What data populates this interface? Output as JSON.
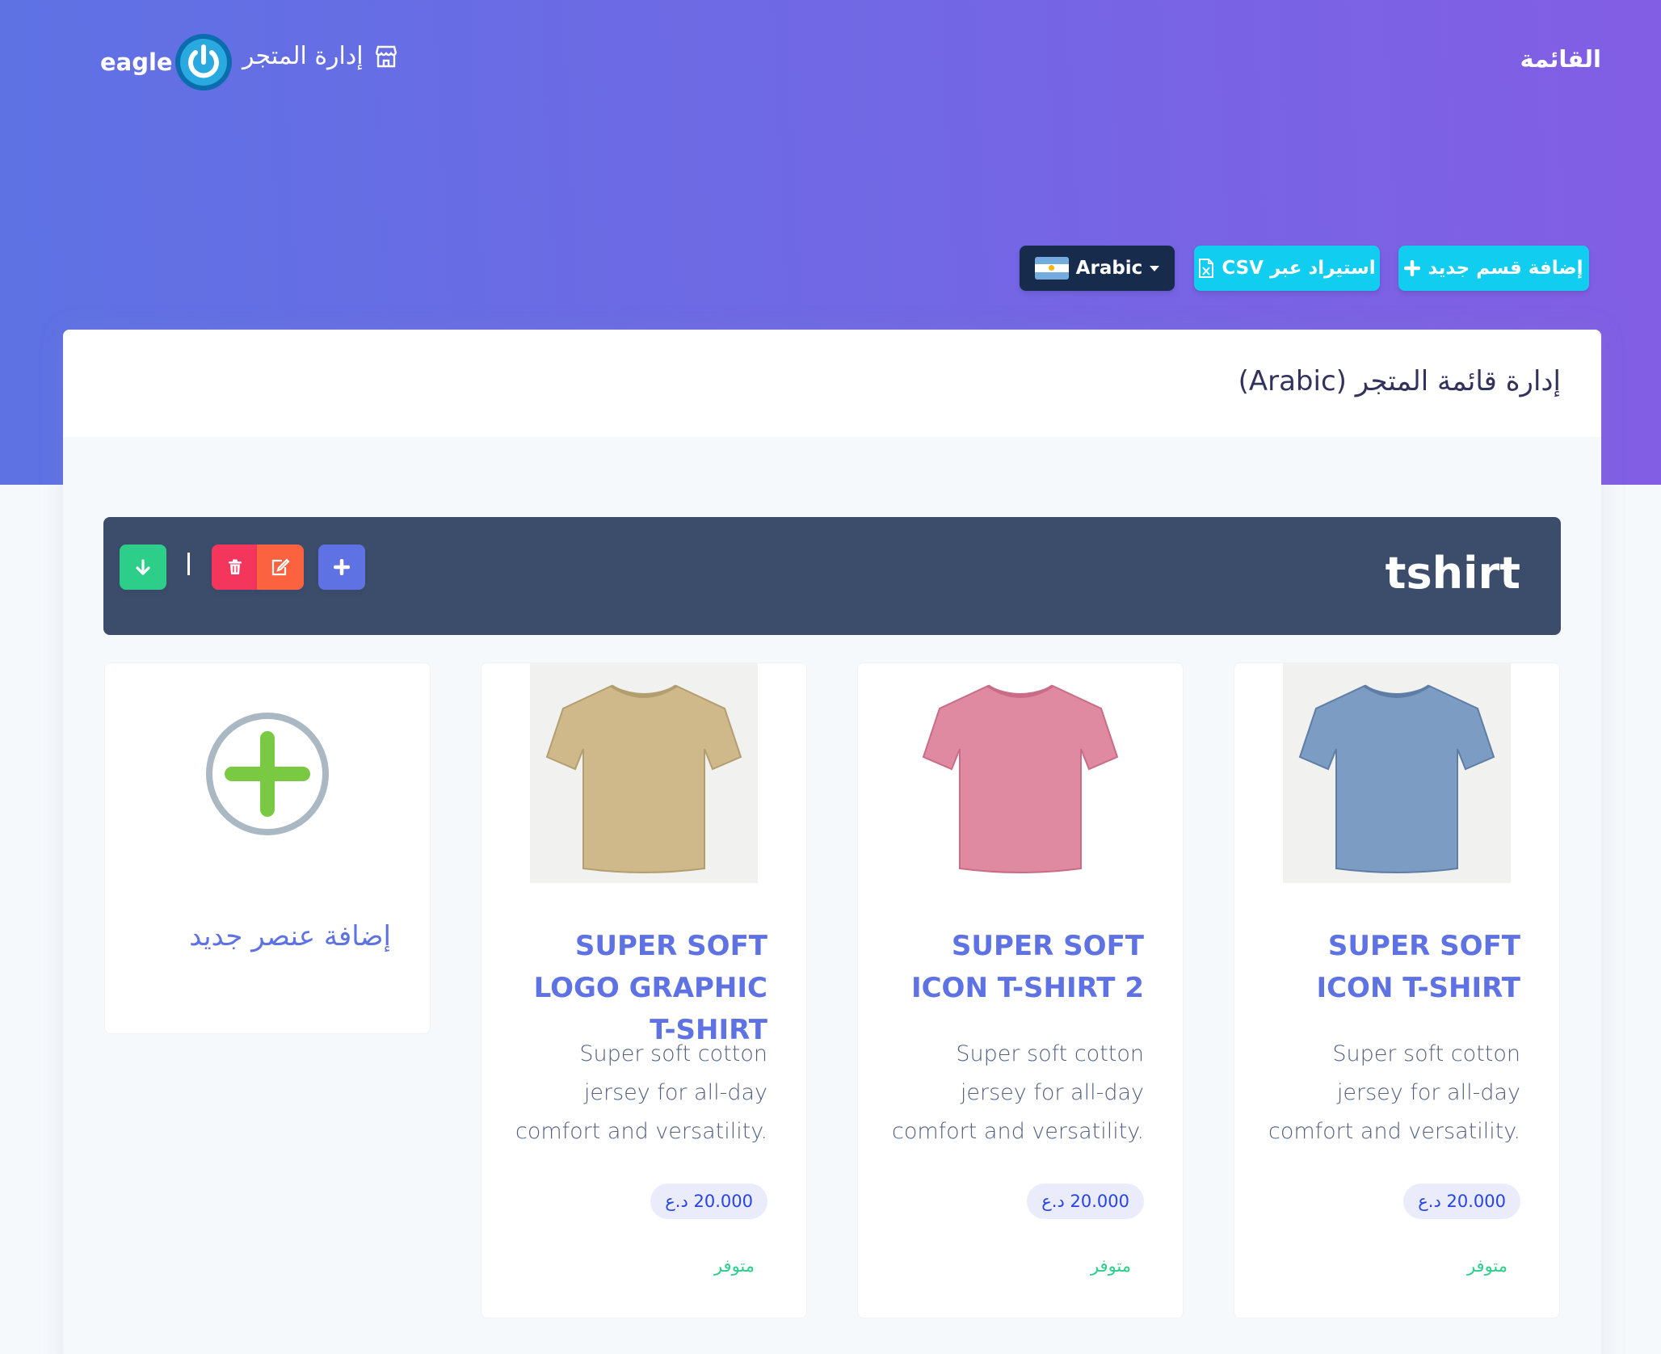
{
  "nav": {
    "menu_label": "القائمة",
    "brand_text": "eagle",
    "store_admin_label": "إدارة المتجر"
  },
  "actions": {
    "add_section_label": "إضافة قسم جديد",
    "import_csv_label": "استيراد عبر CSV",
    "language_label": "Arabic"
  },
  "page": {
    "title": "إدارة قائمة المتجر (Arabic)"
  },
  "section": {
    "title": "tshirt"
  },
  "items": [
    {
      "name": "SUPER SOFT ICON T-SHIRT",
      "description": "Super soft cotton jersey for all-day comfort and versatility.",
      "price": "20.000 د.ع",
      "status": "متوفر",
      "shirt_color": "#7d9cc4"
    },
    {
      "name": "SUPER SOFT ICON T-SHIRT 2",
      "description": "Super soft cotton jersey for all-day comfort and versatility.",
      "price": "20.000 د.ع",
      "status": "متوفر",
      "shirt_color": "#e08aa2"
    },
    {
      "name": "SUPER SOFT LOGO GRAPHIC T-SHIRT",
      "description": "Super soft cotton jersey for all-day comfort and versatility.",
      "price": "20.000 د.ع",
      "status": "متوفر",
      "shirt_color": "#cfb98a"
    }
  ],
  "add_item_label": "إضافة عنصر جديد",
  "colors": {
    "primary": "#5e72e4",
    "info": "#11cdef",
    "success": "#2dce89",
    "danger": "#f5365c",
    "warning": "#fb6340",
    "dark": "#172b4d",
    "section_bar": "#3c4d6b"
  }
}
